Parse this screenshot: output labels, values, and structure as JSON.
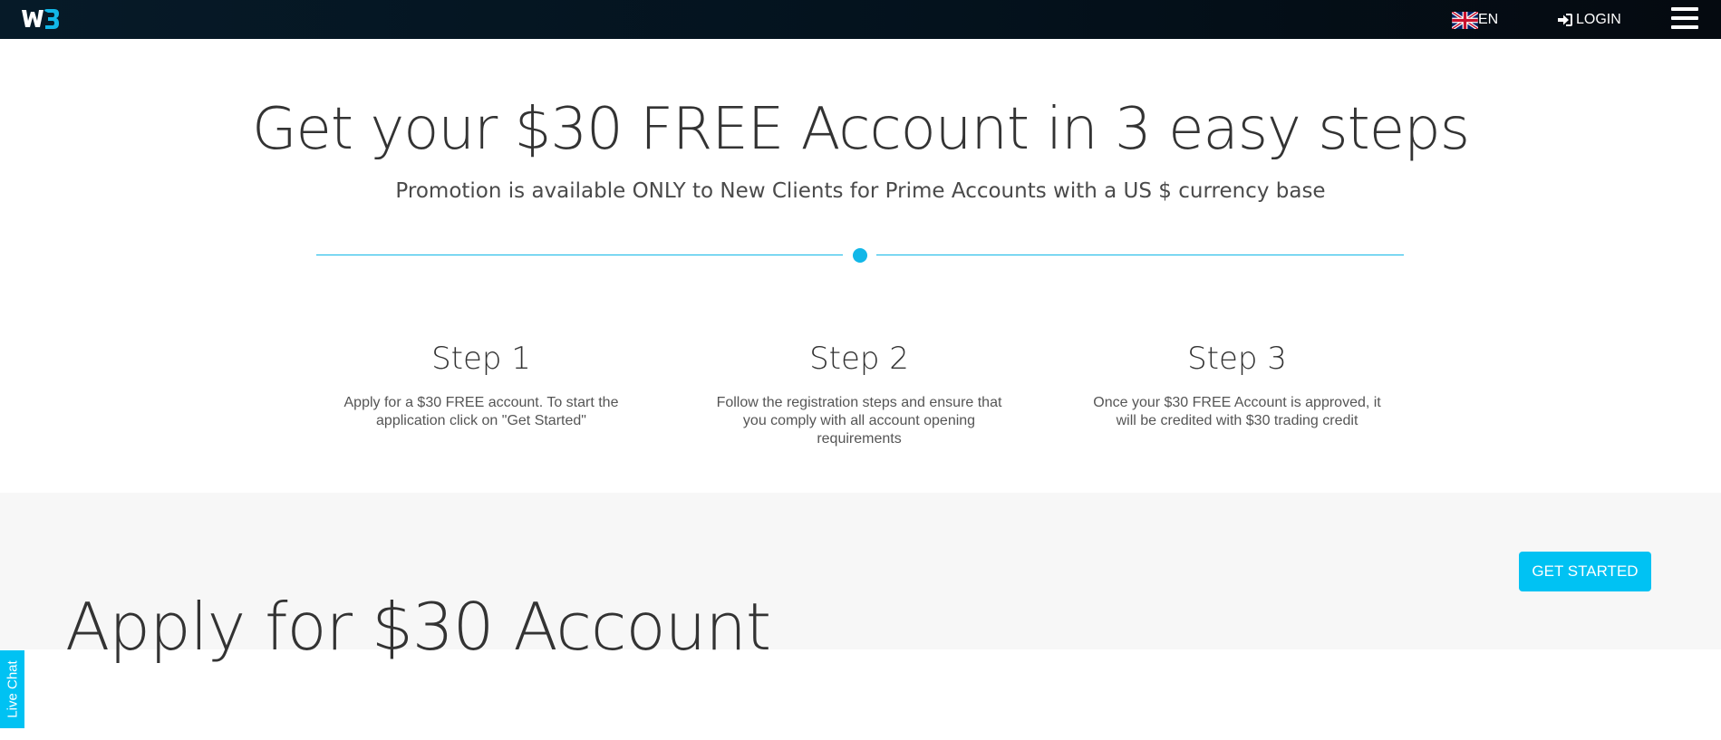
{
  "nav": {
    "language": "EN",
    "login_label": "LOGIN",
    "icons": {
      "logo": "w3-logo-icon",
      "flag": "uk-flag-icon",
      "login": "sign-in-icon",
      "menu": "hamburger-menu-icon"
    }
  },
  "hero": {
    "title": "Get your $30 FREE Account in 3 easy steps",
    "subtitle": "Promotion is available ONLY to New Clients for Prime Accounts with a US $ currency base"
  },
  "steps": [
    {
      "title": "Step 1",
      "text": "Apply for a $30 FREE account. To start the application click on \"Get Started\""
    },
    {
      "title": "Step 2",
      "text": "Follow the registration steps and ensure that you comply with all account opening requirements"
    },
    {
      "title": "Step 3",
      "text": "Once your $30 FREE Account is approved, it will be credited with $30 trading credit"
    }
  ],
  "apply": {
    "title": "Apply for $30 Account",
    "button_label": "GET STARTED"
  },
  "live_chat": {
    "label": "Live Chat"
  },
  "colors": {
    "accent": "#12b7e8",
    "button": "#00c2f3",
    "navbar": "#061a28",
    "band": "#f7f7f7"
  }
}
